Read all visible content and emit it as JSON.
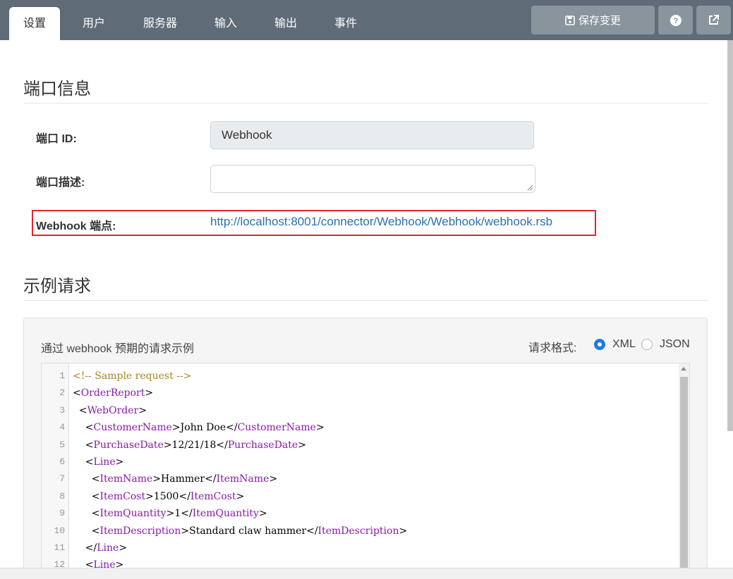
{
  "tabs": [
    {
      "label": "设置",
      "active": true
    },
    {
      "label": "用户",
      "active": false
    },
    {
      "label": "服务器",
      "active": false
    },
    {
      "label": "输入",
      "active": false
    },
    {
      "label": "输出",
      "active": false
    },
    {
      "label": "事件",
      "active": false
    }
  ],
  "toolbar": {
    "save_label": "保存变更",
    "save_icon": "floppy-disk-icon",
    "help_icon": "question-circle-icon",
    "external_icon": "external-link-icon"
  },
  "port_info": {
    "title": "端口信息",
    "id_label": "端口 ID:",
    "id_value": "Webhook",
    "desc_label": "端口描述:",
    "desc_value": "",
    "endpoint_label": "Webhook 端点:",
    "endpoint_url": "http://localhost:8001/connector/Webhook/Webhook/webhook.rsb"
  },
  "sample_request": {
    "title": "示例请求",
    "description": "通过 webhook 预期的请求示例",
    "format_label": "请求格式:",
    "formats": [
      {
        "label": "XML",
        "selected": true
      },
      {
        "label": "JSON",
        "selected": false
      }
    ],
    "code_lines": [
      {
        "n": "1",
        "parts": [
          {
            "t": "<!-- Sample request -->",
            "c": "comment"
          }
        ]
      },
      {
        "n": "2",
        "parts": [
          {
            "t": "<",
            "c": "txt"
          },
          {
            "t": "OrderReport",
            "c": "tag"
          },
          {
            "t": ">",
            "c": "txt"
          }
        ]
      },
      {
        "n": "3",
        "parts": [
          {
            "t": "  <",
            "c": "txt"
          },
          {
            "t": "WebOrder",
            "c": "tag"
          },
          {
            "t": ">",
            "c": "txt"
          }
        ]
      },
      {
        "n": "4",
        "parts": [
          {
            "t": "    <",
            "c": "txt"
          },
          {
            "t": "CustomerName",
            "c": "tag"
          },
          {
            "t": ">John Doe</",
            "c": "txt"
          },
          {
            "t": "CustomerName",
            "c": "tag"
          },
          {
            "t": ">",
            "c": "txt"
          }
        ]
      },
      {
        "n": "5",
        "parts": [
          {
            "t": "    <",
            "c": "txt"
          },
          {
            "t": "PurchaseDate",
            "c": "tag"
          },
          {
            "t": ">12/21/18</",
            "c": "txt"
          },
          {
            "t": "PurchaseDate",
            "c": "tag"
          },
          {
            "t": ">",
            "c": "txt"
          }
        ]
      },
      {
        "n": "6",
        "parts": [
          {
            "t": "    <",
            "c": "txt"
          },
          {
            "t": "Line",
            "c": "tag"
          },
          {
            "t": ">",
            "c": "txt"
          }
        ]
      },
      {
        "n": "7",
        "parts": [
          {
            "t": "      <",
            "c": "txt"
          },
          {
            "t": "ItemName",
            "c": "tag"
          },
          {
            "t": ">Hammer</",
            "c": "txt"
          },
          {
            "t": "ItemName",
            "c": "tag"
          },
          {
            "t": ">",
            "c": "txt"
          }
        ]
      },
      {
        "n": "8",
        "parts": [
          {
            "t": "      <",
            "c": "txt"
          },
          {
            "t": "ItemCost",
            "c": "tag"
          },
          {
            "t": ">1500</",
            "c": "txt"
          },
          {
            "t": "ItemCost",
            "c": "tag"
          },
          {
            "t": ">",
            "c": "txt"
          }
        ]
      },
      {
        "n": "9",
        "parts": [
          {
            "t": "      <",
            "c": "txt"
          },
          {
            "t": "ItemQuantity",
            "c": "tag"
          },
          {
            "t": ">1</",
            "c": "txt"
          },
          {
            "t": "ItemQuantity",
            "c": "tag"
          },
          {
            "t": ">",
            "c": "txt"
          }
        ]
      },
      {
        "n": "10",
        "parts": [
          {
            "t": "      <",
            "c": "txt"
          },
          {
            "t": "ItemDescription",
            "c": "tag"
          },
          {
            "t": ">Standard claw hammer</",
            "c": "txt"
          },
          {
            "t": "ItemDescription",
            "c": "tag"
          },
          {
            "t": ">",
            "c": "txt"
          }
        ]
      },
      {
        "n": "11",
        "parts": [
          {
            "t": "    </",
            "c": "txt"
          },
          {
            "t": "Line",
            "c": "tag"
          },
          {
            "t": ">",
            "c": "txt"
          }
        ]
      },
      {
        "n": "12",
        "parts": [
          {
            "t": "    <",
            "c": "txt"
          },
          {
            "t": "Line",
            "c": "tag"
          },
          {
            "t": ">",
            "c": "txt"
          }
        ]
      }
    ]
  },
  "colors": {
    "topbar": "#5f6b77",
    "button": "#8a949d",
    "link": "#2f6fb0",
    "highlight": "#e3262a",
    "radio_selected": "#1f7ae0",
    "xml_tag": "#8a1aa8",
    "xml_comment": "#a5871e"
  }
}
